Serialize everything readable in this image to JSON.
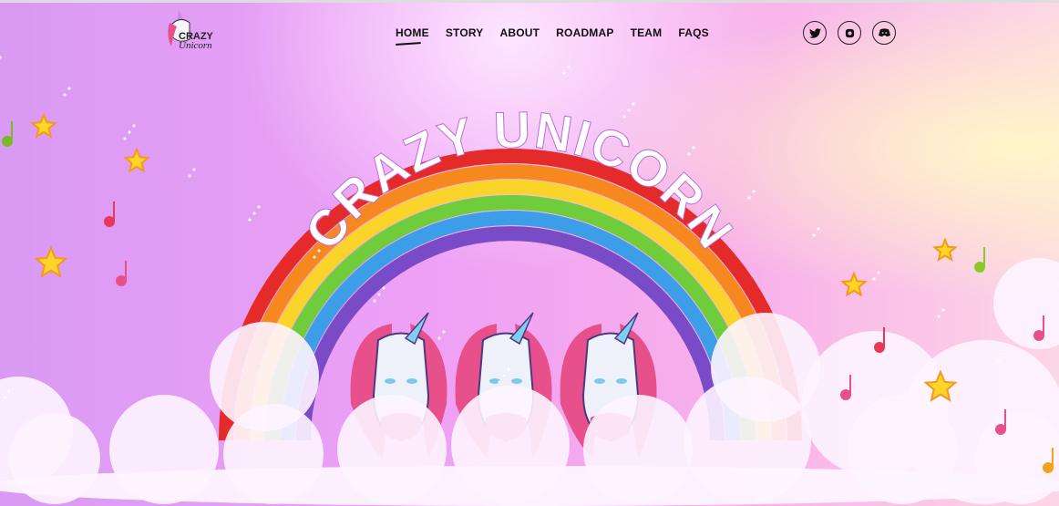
{
  "logo": {
    "line1": "CRAZY",
    "line2": "Unicorn"
  },
  "nav": {
    "items": [
      "HOME",
      "STORY",
      "ABOUT",
      "ROADMAP",
      "TEAM",
      "FAQS"
    ],
    "active": "HOME"
  },
  "social": [
    {
      "icon": "twitter-icon",
      "glyph": "🐦"
    },
    {
      "icon": "instagram-icon",
      "glyph": "◘"
    },
    {
      "icon": "discord-icon",
      "glyph": "◉"
    }
  ],
  "hero": {
    "title": "CRAZY UNICORN"
  },
  "colors": {
    "rainbow": [
      "#e52a2a",
      "#f7881f",
      "#fbd42a",
      "#6fcd3c",
      "#3c9ee8",
      "#7a4bc6"
    ]
  }
}
